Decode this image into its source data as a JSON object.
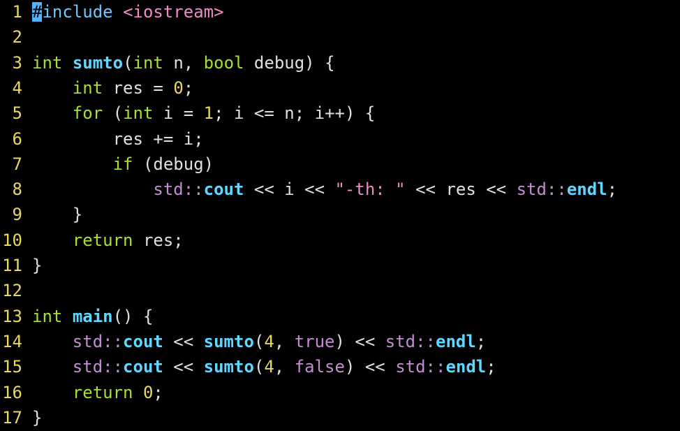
{
  "editor": {
    "colors": {
      "background": "#000000",
      "line_number": "#e8d85c",
      "text": "#e0e0e0",
      "keyword": "#a6e22e",
      "type": "#a6e22e",
      "function": "#5fd7ff",
      "string": "#f08cc4",
      "number": "#e8d85c",
      "namespace": "#c58bd6",
      "preproc": "#6ec6ff",
      "cursor": "#4fb3ff"
    },
    "lines": [
      {
        "num": "1",
        "tokens": [
          {
            "t": "#",
            "k": "cursor"
          },
          {
            "t": "include",
            "k": "preproc"
          },
          {
            "t": " ",
            "k": "plain"
          },
          {
            "t": "<iostream>",
            "k": "string"
          }
        ]
      },
      {
        "num": "2",
        "tokens": []
      },
      {
        "num": "3",
        "tokens": [
          {
            "t": "int",
            "k": "type"
          },
          {
            "t": " ",
            "k": "plain"
          },
          {
            "t": "sumto",
            "k": "function"
          },
          {
            "t": "(",
            "k": "plain"
          },
          {
            "t": "int",
            "k": "type"
          },
          {
            "t": " n, ",
            "k": "plain"
          },
          {
            "t": "bool",
            "k": "type"
          },
          {
            "t": " debug) {",
            "k": "plain"
          }
        ]
      },
      {
        "num": "4",
        "tokens": [
          {
            "t": "    ",
            "k": "plain"
          },
          {
            "t": "int",
            "k": "type"
          },
          {
            "t": " res = ",
            "k": "plain"
          },
          {
            "t": "0",
            "k": "number"
          },
          {
            "t": ";",
            "k": "plain"
          }
        ]
      },
      {
        "num": "5",
        "tokens": [
          {
            "t": "    ",
            "k": "plain"
          },
          {
            "t": "for",
            "k": "keyword"
          },
          {
            "t": " (",
            "k": "plain"
          },
          {
            "t": "int",
            "k": "type"
          },
          {
            "t": " i = ",
            "k": "plain"
          },
          {
            "t": "1",
            "k": "number"
          },
          {
            "t": "; i <= n; i++) {",
            "k": "plain"
          }
        ]
      },
      {
        "num": "6",
        "tokens": [
          {
            "t": "        res += i;",
            "k": "plain"
          }
        ]
      },
      {
        "num": "7",
        "tokens": [
          {
            "t": "        ",
            "k": "plain"
          },
          {
            "t": "if",
            "k": "keyword"
          },
          {
            "t": " (debug)",
            "k": "plain"
          }
        ]
      },
      {
        "num": "8",
        "tokens": [
          {
            "t": "            ",
            "k": "plain"
          },
          {
            "t": "std::",
            "k": "namespace"
          },
          {
            "t": "cout",
            "k": "function"
          },
          {
            "t": " << i << ",
            "k": "plain"
          },
          {
            "t": "\"-th: \"",
            "k": "string"
          },
          {
            "t": " << res << ",
            "k": "plain"
          },
          {
            "t": "std::",
            "k": "namespace"
          },
          {
            "t": "endl",
            "k": "function"
          },
          {
            "t": ";",
            "k": "plain"
          }
        ]
      },
      {
        "num": "9",
        "tokens": [
          {
            "t": "    }",
            "k": "plain"
          }
        ]
      },
      {
        "num": "10",
        "tokens": [
          {
            "t": "    ",
            "k": "plain"
          },
          {
            "t": "return",
            "k": "keyword"
          },
          {
            "t": " res;",
            "k": "plain"
          }
        ]
      },
      {
        "num": "11",
        "tokens": [
          {
            "t": "}",
            "k": "plain"
          }
        ]
      },
      {
        "num": "12",
        "tokens": []
      },
      {
        "num": "13",
        "tokens": [
          {
            "t": "int",
            "k": "type"
          },
          {
            "t": " ",
            "k": "plain"
          },
          {
            "t": "main",
            "k": "function"
          },
          {
            "t": "() {",
            "k": "plain"
          }
        ]
      },
      {
        "num": "14",
        "tokens": [
          {
            "t": "    ",
            "k": "plain"
          },
          {
            "t": "std::",
            "k": "namespace"
          },
          {
            "t": "cout",
            "k": "function"
          },
          {
            "t": " << ",
            "k": "plain"
          },
          {
            "t": "sumto",
            "k": "function"
          },
          {
            "t": "(",
            "k": "plain"
          },
          {
            "t": "4",
            "k": "number"
          },
          {
            "t": ", ",
            "k": "plain"
          },
          {
            "t": "true",
            "k": "namespace"
          },
          {
            "t": ") << ",
            "k": "plain"
          },
          {
            "t": "std::",
            "k": "namespace"
          },
          {
            "t": "endl",
            "k": "function"
          },
          {
            "t": ";",
            "k": "plain"
          }
        ]
      },
      {
        "num": "15",
        "tokens": [
          {
            "t": "    ",
            "k": "plain"
          },
          {
            "t": "std::",
            "k": "namespace"
          },
          {
            "t": "cout",
            "k": "function"
          },
          {
            "t": " << ",
            "k": "plain"
          },
          {
            "t": "sumto",
            "k": "function"
          },
          {
            "t": "(",
            "k": "plain"
          },
          {
            "t": "4",
            "k": "number"
          },
          {
            "t": ", ",
            "k": "plain"
          },
          {
            "t": "false",
            "k": "namespace"
          },
          {
            "t": ") << ",
            "k": "plain"
          },
          {
            "t": "std::",
            "k": "namespace"
          },
          {
            "t": "endl",
            "k": "function"
          },
          {
            "t": ";",
            "k": "plain"
          }
        ]
      },
      {
        "num": "16",
        "tokens": [
          {
            "t": "    ",
            "k": "plain"
          },
          {
            "t": "return",
            "k": "keyword"
          },
          {
            "t": " ",
            "k": "plain"
          },
          {
            "t": "0",
            "k": "number"
          },
          {
            "t": ";",
            "k": "plain"
          }
        ]
      },
      {
        "num": "17",
        "tokens": [
          {
            "t": "}",
            "k": "plain"
          }
        ]
      }
    ]
  }
}
